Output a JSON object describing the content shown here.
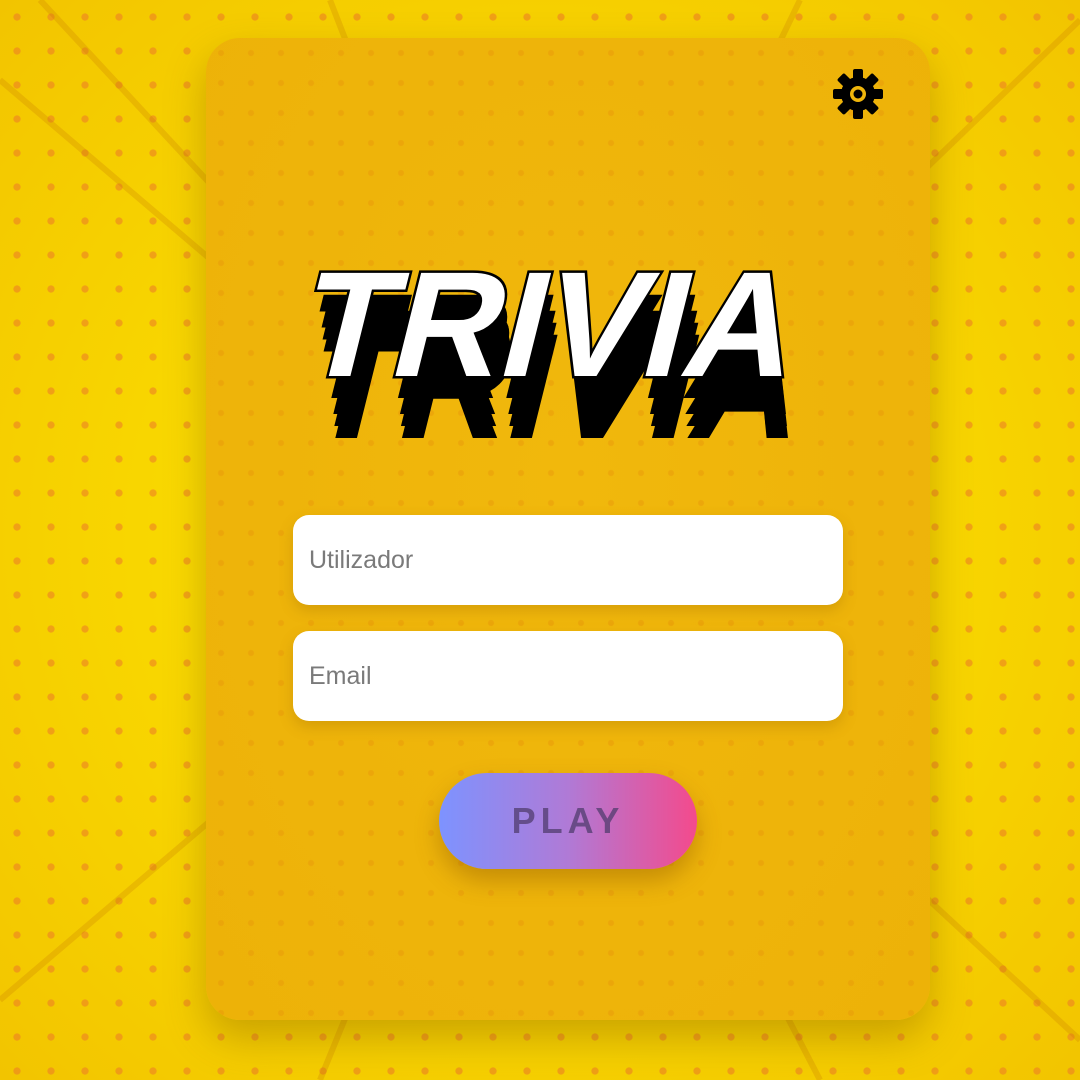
{
  "title": "TRIVIA",
  "settings": {
    "icon": "gear-icon"
  },
  "form": {
    "user_placeholder": "Utilizador",
    "email_placeholder": "Email",
    "play_label": "PLAY"
  },
  "colors": {
    "background": "#f7d900",
    "card": "#eeb40a",
    "play_gradient_start": "#7d93ff",
    "play_gradient_end": "#f44a8c"
  }
}
